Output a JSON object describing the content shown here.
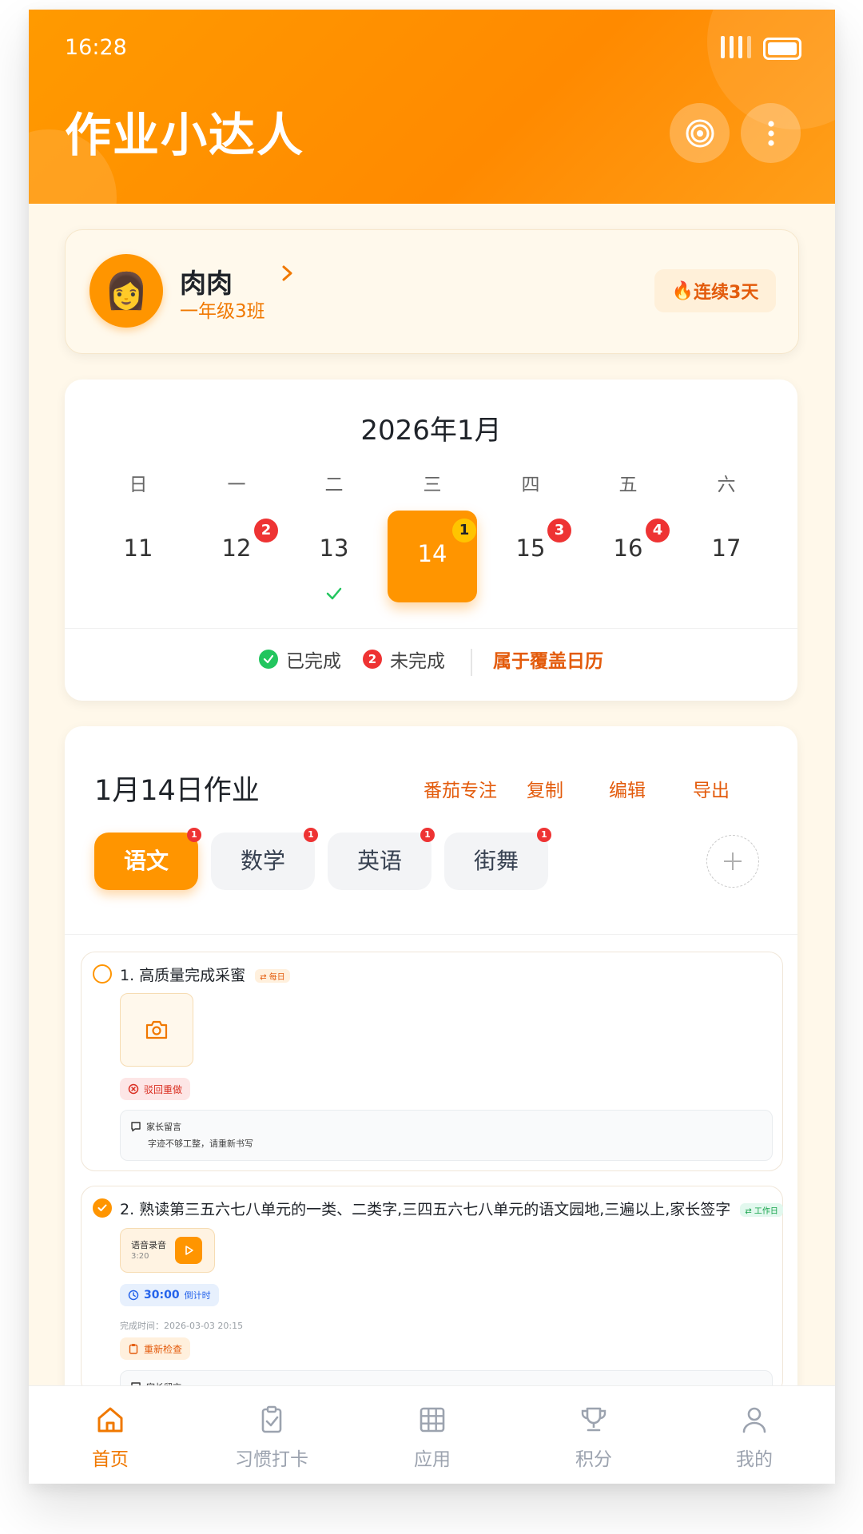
{
  "status": {
    "time": "16:28"
  },
  "header": {
    "title": "作业小达人"
  },
  "profile": {
    "avatar_emoji": "👩",
    "name": "肉肉",
    "class": "一年级3班",
    "streak": "连续3天",
    "streak_icon": "🔥"
  },
  "calendar": {
    "title": "2026年1月",
    "weekdays": [
      "日",
      "一",
      "二",
      "三",
      "四",
      "五",
      "六"
    ],
    "days": [
      "11",
      "12",
      "13",
      "14",
      "15",
      "16",
      "17"
    ],
    "selected_day": "14",
    "badges": {
      "12": "2",
      "14": "1",
      "15": "3",
      "16": "4"
    },
    "legend_done": "已完成",
    "legend_undone": "未完成",
    "legend_undone_badge": "2",
    "overlay_link": "属于覆盖日历"
  },
  "homework": {
    "title": "1月14日作业",
    "actions": [
      "番茄专注",
      "复制",
      "编辑",
      "导出"
    ],
    "subjects": [
      {
        "label": "语文",
        "badge": "1",
        "active": true
      },
      {
        "label": "数学",
        "badge": "1",
        "active": false
      },
      {
        "label": "英语",
        "badge": "1",
        "active": false
      },
      {
        "label": "街舞",
        "badge": "1",
        "active": false
      }
    ],
    "tasks": [
      {
        "title": "1. 高质量完成采蜜",
        "tag": "每日",
        "status_chip": "驳回重做",
        "note_label": "家长留言",
        "note_text": "字迹不够工整，请重新书写"
      },
      {
        "title": "2. 熟读第三五六七八单元的一类、二类字,三四五六七八单元的语文园地,三遍以上,家长签字",
        "tag": "工作日",
        "audio_label": "语音录音",
        "audio_duration": "3:20",
        "timer_value": "30:00",
        "timer_label": "倒计时",
        "done_time": "完成时间：2026-03-03 20:15",
        "status_chip": "重新检查",
        "note_label": "家长留言"
      }
    ]
  },
  "tabbar": [
    {
      "label": "首页",
      "icon": "home-icon",
      "active": true
    },
    {
      "label": "习惯打卡",
      "icon": "clipboard-check-icon",
      "active": false
    },
    {
      "label": "应用",
      "icon": "grid-icon",
      "active": false
    },
    {
      "label": "积分",
      "icon": "trophy-icon",
      "active": false
    },
    {
      "label": "我的",
      "icon": "user-icon",
      "active": false
    }
  ],
  "colors": {
    "accent": "#ff9500",
    "accent_text": "#e35b0c",
    "badge_red": "#ee3333",
    "badge_yellow": "#ffc400",
    "done_green": "#22c55e"
  }
}
